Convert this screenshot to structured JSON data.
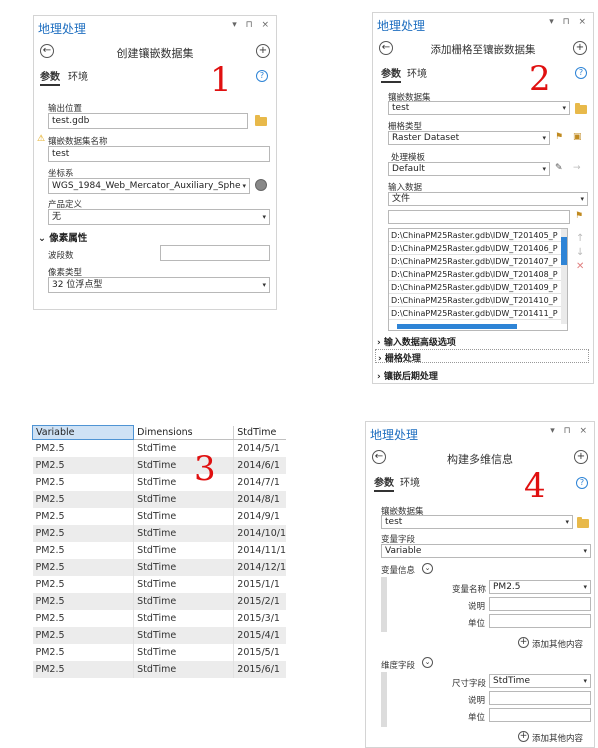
{
  "panel1": {
    "title": "地理处理",
    "controls": "▾ ⊓ ×",
    "tool_name": "创建镶嵌数据集",
    "tabs": [
      "参数",
      "环境"
    ],
    "number": "1",
    "fields": {
      "output_location_label": "输出位置",
      "output_location_value": "test.gdb",
      "dataset_name_label": "镶嵌数据集名称",
      "dataset_name_value": "test",
      "coord_label": "坐标系",
      "coord_value": "WGS_1984_Web_Mercator_Auxiliary_Sphe",
      "product_label": "产品定义",
      "product_value": "无",
      "pixel_section": "像素属性",
      "band_label": "波段数",
      "band_value": "",
      "pixel_type_label": "像素类型",
      "pixel_type_value": "32 位浮点型"
    }
  },
  "panel2": {
    "title": "地理处理",
    "controls": "▾ ⊓ ×",
    "tool_name": "添加栅格至镶嵌数据集",
    "tabs": [
      "参数",
      "环境"
    ],
    "number": "2",
    "fields": {
      "mosaic_label": "镶嵌数据集",
      "mosaic_value": "test",
      "raster_type_label": "栅格类型",
      "raster_type_value": "Raster Dataset",
      "template_label": "处理模板",
      "template_value": "Default",
      "input_label": "输入数据",
      "input_value": "文件",
      "input_text": ""
    },
    "files": [
      "D:\\ChinaPM25Raster.gdb\\IDW_T201405_P",
      "D:\\ChinaPM25Raster.gdb\\IDW_T201406_P",
      "D:\\ChinaPM25Raster.gdb\\IDW_T201407_P",
      "D:\\ChinaPM25Raster.gdb\\IDW_T201408_P",
      "D:\\ChinaPM25Raster.gdb\\IDW_T201409_P",
      "D:\\ChinaPM25Raster.gdb\\IDW_T201410_P",
      "D:\\ChinaPM25Raster.gdb\\IDW_T201411_P"
    ],
    "sections": [
      "输入数据高级选项",
      "栅格处理",
      "镶嵌后期处理"
    ]
  },
  "table": {
    "number": "3",
    "headers": [
      "Variable",
      "Dimensions",
      "StdTime"
    ],
    "rows": [
      [
        "PM2.5",
        "StdTime",
        "2014/5/1"
      ],
      [
        "PM2.5",
        "StdTime",
        "2014/6/1"
      ],
      [
        "PM2.5",
        "StdTime",
        "2014/7/1"
      ],
      [
        "PM2.5",
        "StdTime",
        "2014/8/1"
      ],
      [
        "PM2.5",
        "StdTime",
        "2014/9/1"
      ],
      [
        "PM2.5",
        "StdTime",
        "2014/10/1"
      ],
      [
        "PM2.5",
        "StdTime",
        "2014/11/1"
      ],
      [
        "PM2.5",
        "StdTime",
        "2014/12/1"
      ],
      [
        "PM2.5",
        "StdTime",
        "2015/1/1"
      ],
      [
        "PM2.5",
        "StdTime",
        "2015/2/1"
      ],
      [
        "PM2.5",
        "StdTime",
        "2015/3/1"
      ],
      [
        "PM2.5",
        "StdTime",
        "2015/4/1"
      ],
      [
        "PM2.5",
        "StdTime",
        "2015/5/1"
      ],
      [
        "PM2.5",
        "StdTime",
        "2015/6/1"
      ]
    ]
  },
  "panel4": {
    "title": "地理处理",
    "controls": "▾ ⊓ ×",
    "tool_name": "构建多维信息",
    "tabs": [
      "参数",
      "环境"
    ],
    "number": "4",
    "fields": {
      "mosaic_label": "镶嵌数据集",
      "mosaic_value": "test",
      "var_field_label": "变量字段",
      "var_field_value": "Variable",
      "var_info_label": "变量信息",
      "var_name_label": "变量名称",
      "var_name_value": "PM2.5",
      "desc_label": "说明",
      "unit_label": "单位",
      "add_more": "添加其他内容",
      "dim_field_label": "维度字段",
      "dim_name_label": "尺寸字段",
      "dim_name_value": "StdTime",
      "desc2_label": "说明",
      "unit2_label": "单位",
      "add_more2": "添加其他内容"
    }
  },
  "colors": {
    "accent": "#1f6fc0",
    "number": "#e01010",
    "folder": "#e8b94a"
  }
}
